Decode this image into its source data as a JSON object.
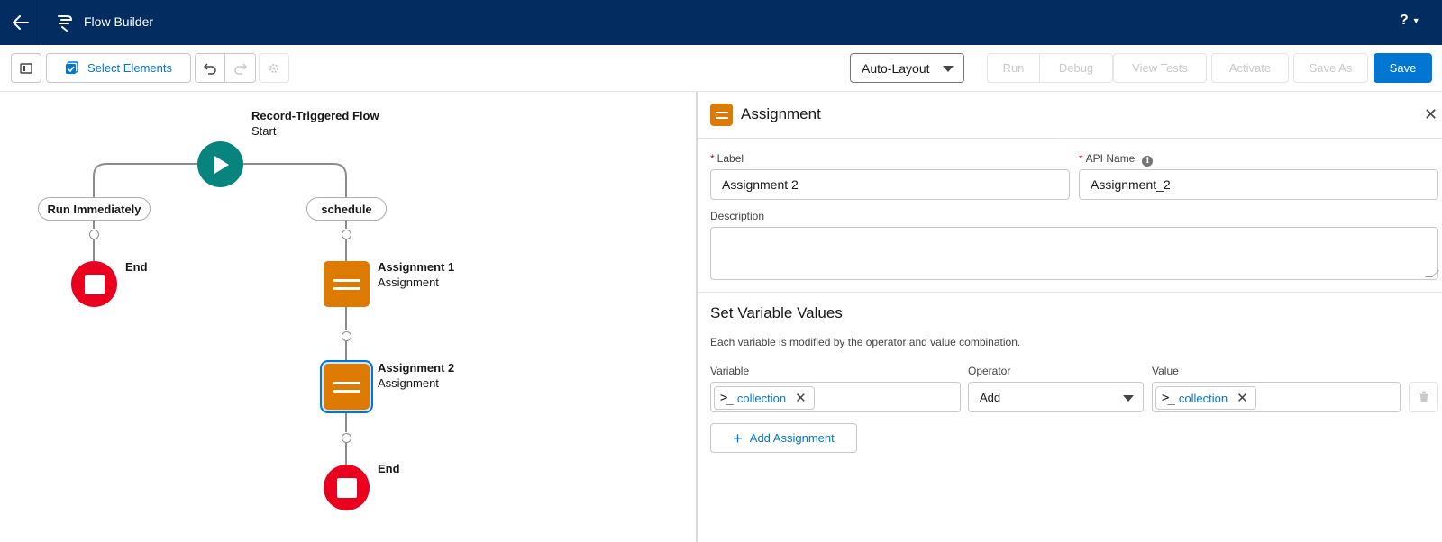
{
  "header": {
    "app_title": "Flow Builder",
    "help_label": "?",
    "icons": {
      "back": "arrow-left-icon",
      "app": "flow-icon",
      "help": "question-icon"
    }
  },
  "toolbar": {
    "select_elements_label": "Select Elements",
    "layout_value": "Auto-Layout",
    "run_label": "Run",
    "debug_label": "Debug",
    "view_tests_label": "View Tests",
    "activate_label": "Activate",
    "save_as_label": "Save As",
    "save_label": "Save",
    "accent_color": "#0176d3"
  },
  "canvas": {
    "start": {
      "title": "Record-Triggered Flow",
      "subtitle": "Start"
    },
    "paths": [
      {
        "label": "Run Immediately"
      },
      {
        "label": "schedule"
      }
    ],
    "end_left": {
      "label": "End"
    },
    "assignment1": {
      "title": "Assignment 1",
      "subtitle": "Assignment"
    },
    "assignment2": {
      "title": "Assignment 2",
      "subtitle": "Assignment"
    },
    "end_right": {
      "label": "End"
    },
    "colors": {
      "start": "#06847d",
      "end": "#ea001e",
      "assignment": "#dd7a01"
    }
  },
  "panel": {
    "title": "Assignment",
    "label_field": {
      "label": "Label",
      "value": "Assignment 2"
    },
    "api_name_field": {
      "label": "API Name",
      "value": "Assignment_2"
    },
    "description_field": {
      "label": "Description",
      "value": ""
    },
    "section_title": "Set Variable Values",
    "section_desc": "Each variable is modified by the operator and value combination.",
    "columns": {
      "variable": "Variable",
      "operator": "Operator",
      "value": "Value"
    },
    "row": {
      "variable": "collection",
      "operator": "Add",
      "value": "collection"
    },
    "add_button_label": "Add Assignment"
  }
}
